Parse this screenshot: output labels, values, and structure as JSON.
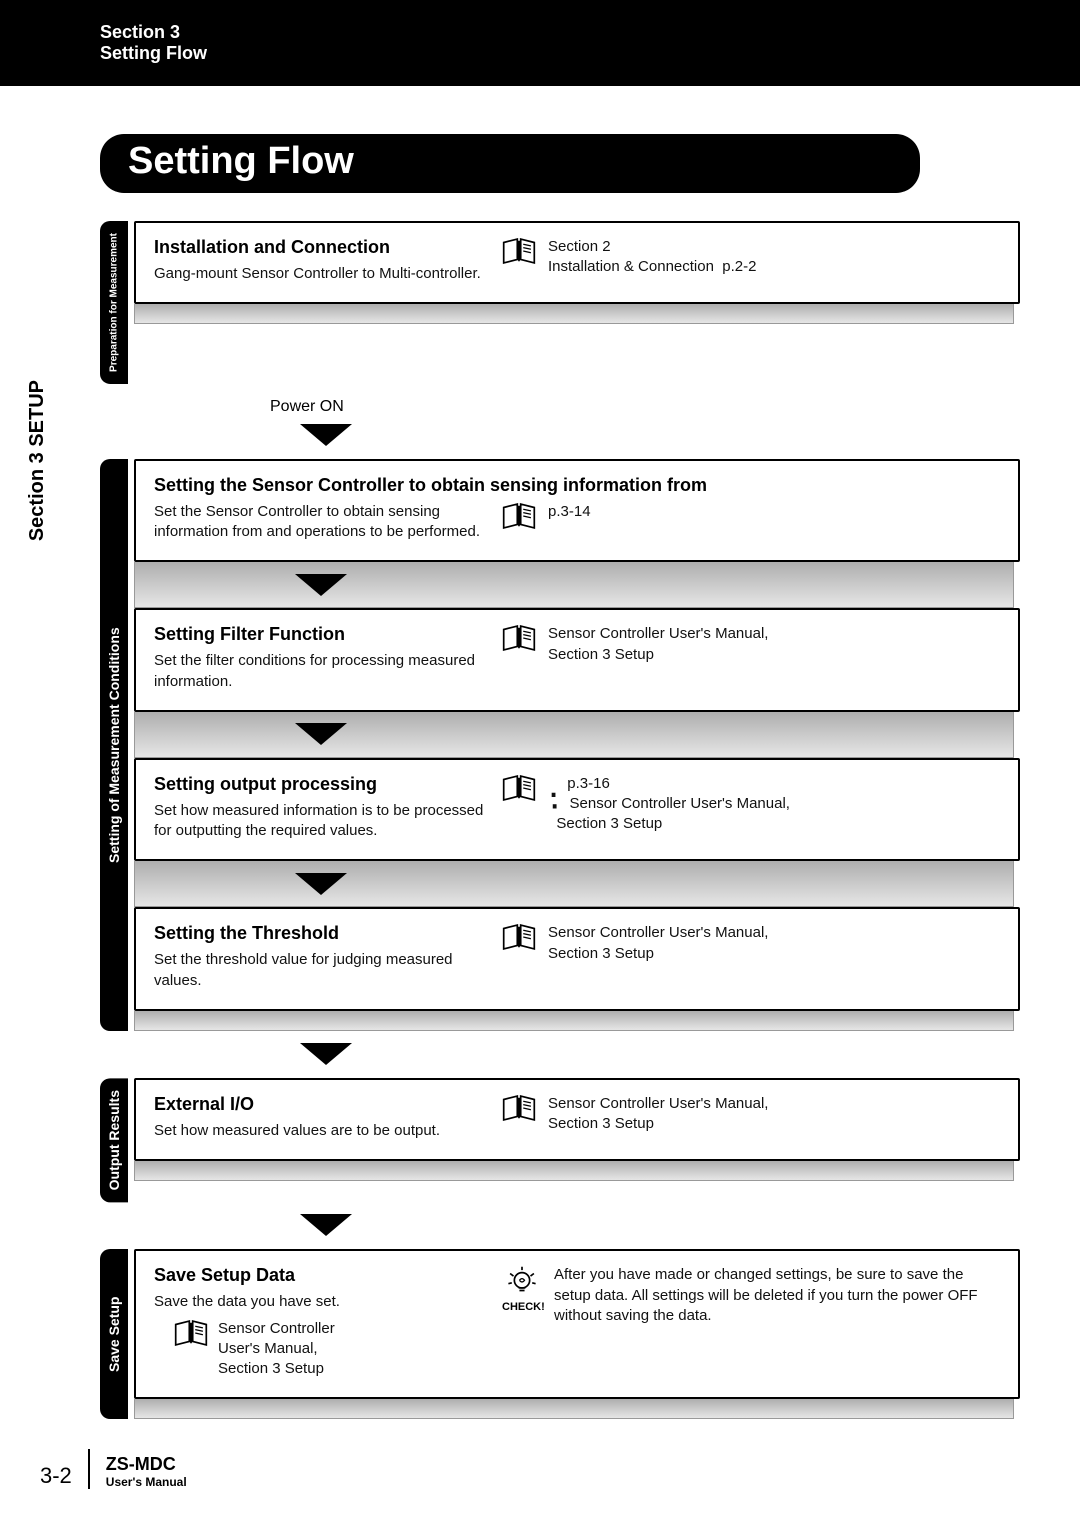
{
  "header": {
    "section": "Section 3",
    "title": "Setting Flow"
  },
  "sideTab": "Section 3   SETUP",
  "pageTitle": "Setting Flow",
  "powerOn": "Power ON",
  "groups": {
    "prep": {
      "tab": "Preparation for Measurement",
      "card1": {
        "title": "Installation and Connection",
        "desc": "Gang-mount Sensor Controller to Multi-controller.",
        "ref1": "Section 2",
        "ref2": "Installation & Connection",
        "pref": "p.2-2"
      }
    },
    "cond": {
      "tab": "Setting of Measurement Conditions",
      "card1": {
        "title": "Setting the Sensor Controller to obtain sensing information from",
        "desc": "Set the Sensor Controller to obtain sensing information from and operations to be performed.",
        "pref": "p.3-14"
      },
      "card2": {
        "title": "Setting Filter Function",
        "desc": "Set the filter conditions for processing measured information.",
        "ref1": "Sensor Controller User's Manual,",
        "ref2": "Section 3 Setup"
      },
      "card3": {
        "title": "Setting output processing",
        "desc": "Set how measured information is to be processed for outputting the required values.",
        "pref": "p.3-16",
        "ref1": "Sensor Controller User's Manual,",
        "ref2": "Section 3 Setup"
      },
      "card4": {
        "title": "Setting the Threshold",
        "desc": "Set the threshold value for judging measured values.",
        "ref1": "Sensor Controller User's Manual,",
        "ref2": "Section 3 Setup"
      }
    },
    "out": {
      "tab": "Output Results",
      "card1": {
        "title": "External I/O",
        "desc": "Set how measured values are to be output.",
        "ref1": "Sensor Controller User's Manual,",
        "ref2": "Section 3 Setup"
      }
    },
    "save": {
      "tab": "Save Setup",
      "card1": {
        "title": "Save Setup Data",
        "desc": "Save the data you have set.",
        "subref1": "Sensor Controller",
        "subref2": "User's Manual,",
        "subref3": "Section 3 Setup",
        "checkLabel": "CHECK!",
        "checkText": "After you have made or changed settings, be sure to save the setup data. All settings will be deleted if you turn the power OFF without saving the data."
      }
    }
  },
  "footer": {
    "page": "3-2",
    "model": "ZS-MDC",
    "manual": "User's Manual"
  }
}
